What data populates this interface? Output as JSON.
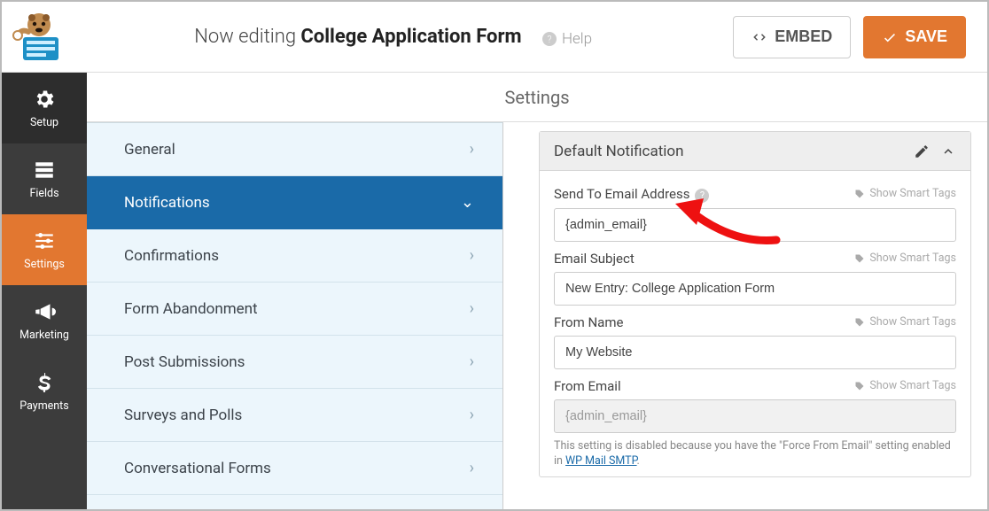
{
  "header": {
    "editing_prefix": "Now editing ",
    "form_name": "College Application Form",
    "help_label": "Help",
    "embed_label": "EMBED",
    "save_label": "SAVE"
  },
  "sidebar": {
    "items": [
      {
        "id": "setup",
        "label": "Setup"
      },
      {
        "id": "fields",
        "label": "Fields"
      },
      {
        "id": "settings",
        "label": "Settings"
      },
      {
        "id": "marketing",
        "label": "Marketing"
      },
      {
        "id": "payments",
        "label": "Payments"
      }
    ],
    "active_id": "settings"
  },
  "panel_title": "Settings",
  "settings_list": {
    "items": [
      {
        "id": "general",
        "label": "General"
      },
      {
        "id": "notifications",
        "label": "Notifications"
      },
      {
        "id": "confirmations",
        "label": "Confirmations"
      },
      {
        "id": "abandonment",
        "label": "Form Abandonment"
      },
      {
        "id": "post_submissions",
        "label": "Post Submissions"
      },
      {
        "id": "surveys",
        "label": "Surveys and Polls"
      },
      {
        "id": "conversational",
        "label": "Conversational Forms"
      }
    ],
    "active_id": "notifications"
  },
  "notification_card": {
    "title": "Default Notification",
    "smart_tags_label": "Show Smart Tags",
    "fields": {
      "send_to": {
        "label": "Send To Email Address",
        "value": "{admin_email}",
        "has_help": true
      },
      "subject": {
        "label": "Email Subject",
        "value": "New Entry: College Application Form"
      },
      "from_name": {
        "label": "From Name",
        "value": "My Website"
      },
      "from_email": {
        "label": "From Email",
        "value": "{admin_email}",
        "disabled": true
      }
    },
    "note_prefix": "This setting is disabled because you have the \"Force From Email\" setting enabled in ",
    "note_link_text": "WP Mail SMTP",
    "note_suffix": "."
  }
}
